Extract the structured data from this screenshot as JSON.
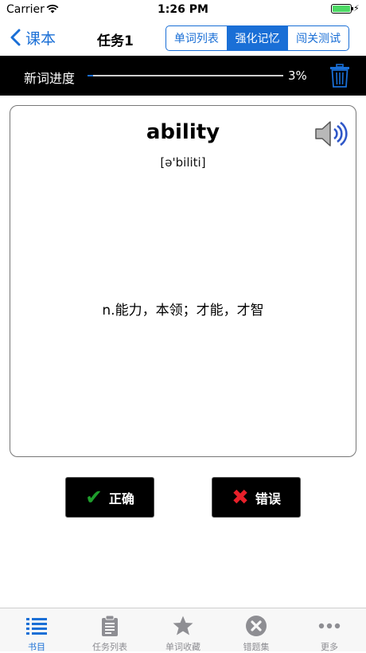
{
  "status_bar": {
    "carrier": "Carrier",
    "time": "1:26 PM"
  },
  "nav": {
    "back_label": "课本",
    "title": "任务1",
    "segments": [
      "单词列表",
      "强化记忆",
      "闯关测试"
    ],
    "active_segment": 1
  },
  "progress": {
    "label": "新词进度",
    "percent_text": "3%",
    "value": 0.03
  },
  "card": {
    "word": "ability",
    "phonetic": "[ə'biliti]",
    "meaning": "n.能力，本领；才能，才智"
  },
  "actions": {
    "correct_label": "正确",
    "wrong_label": "错误"
  },
  "tabbar": {
    "items": [
      {
        "label": "书目",
        "icon": "list-icon"
      },
      {
        "label": "任务列表",
        "icon": "clipboard-icon"
      },
      {
        "label": "单词收藏",
        "icon": "star-icon"
      },
      {
        "label": "错题集",
        "icon": "x-circle-icon"
      },
      {
        "label": "更多",
        "icon": "more-dots-icon"
      }
    ],
    "active_index": 0
  },
  "colors": {
    "accent": "#1a6fd6",
    "band": "#000000",
    "correct": "#1f9e2c",
    "wrong": "#e8202a",
    "tab_inactive": "#8e8e93"
  }
}
